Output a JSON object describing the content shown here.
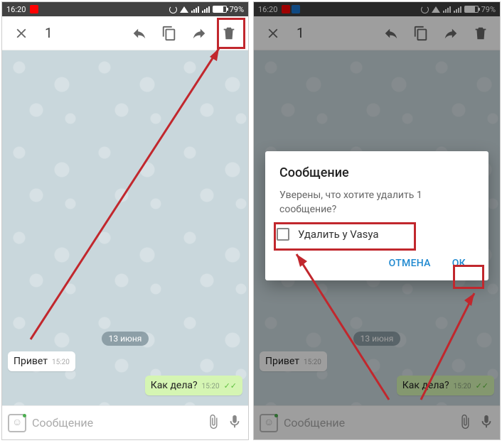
{
  "statusbar": {
    "time": "16:20",
    "battery": "79%"
  },
  "appbar": {
    "selection_count": "1"
  },
  "chat": {
    "date_badge": "13 июня",
    "msg_in_text": "Привет",
    "msg_in_time": "15:20",
    "msg_out_text": "Как дела?",
    "msg_out_time": "15:20"
  },
  "input": {
    "placeholder": "Сообщение"
  },
  "dialog": {
    "title": "Сообщение",
    "body": "Уверены, что хотите удалить 1 сообщение?",
    "checkbox_label": "Удалить у Vasya",
    "cancel": "ОТМЕНА",
    "ok": "ОК"
  }
}
